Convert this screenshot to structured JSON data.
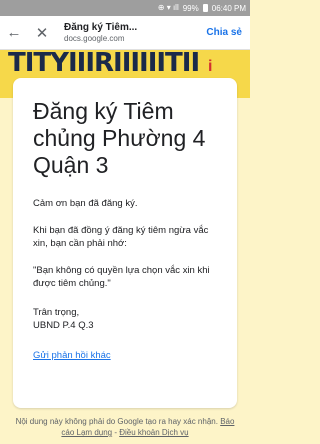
{
  "status_bar": {
    "signal_text": "⊕ ▾ ıll",
    "battery": "99%",
    "time": "06:40 PM"
  },
  "browser": {
    "back_icon": "back-arrow",
    "close_icon": "close-x",
    "title": "Đăng ký Tiêm...",
    "url": "docs.google.com",
    "share_label": "Chia sẻ"
  },
  "banner": {
    "text": "TITYIIIRIIIIIITII",
    "mark": "i"
  },
  "form": {
    "title": "Đăng ký Tiêm chủng Phường 4 Quận 3",
    "thanks": "Cảm ơn bạn đã đăng ký.",
    "note": "Khi bạn đã đồng ý đăng ký tiêm ngừa vắc xin, bạn cần phải nhớ:",
    "quote": "\"Bạn không có quyền lựa chọn vắc xin khi được tiêm chủng.\"",
    "signoff": "Trân trọng,",
    "signer": "UBND P.4 Q.3",
    "feedback_link": "Gửi phản hồi khác"
  },
  "footer": {
    "text": "Nội dung này không phải do Google tạo ra hay xác nhận.",
    "report_link": "Báo cáo Lạm dụng",
    "separator": " - ",
    "terms_link": "Điều khoản Dịch vụ"
  }
}
